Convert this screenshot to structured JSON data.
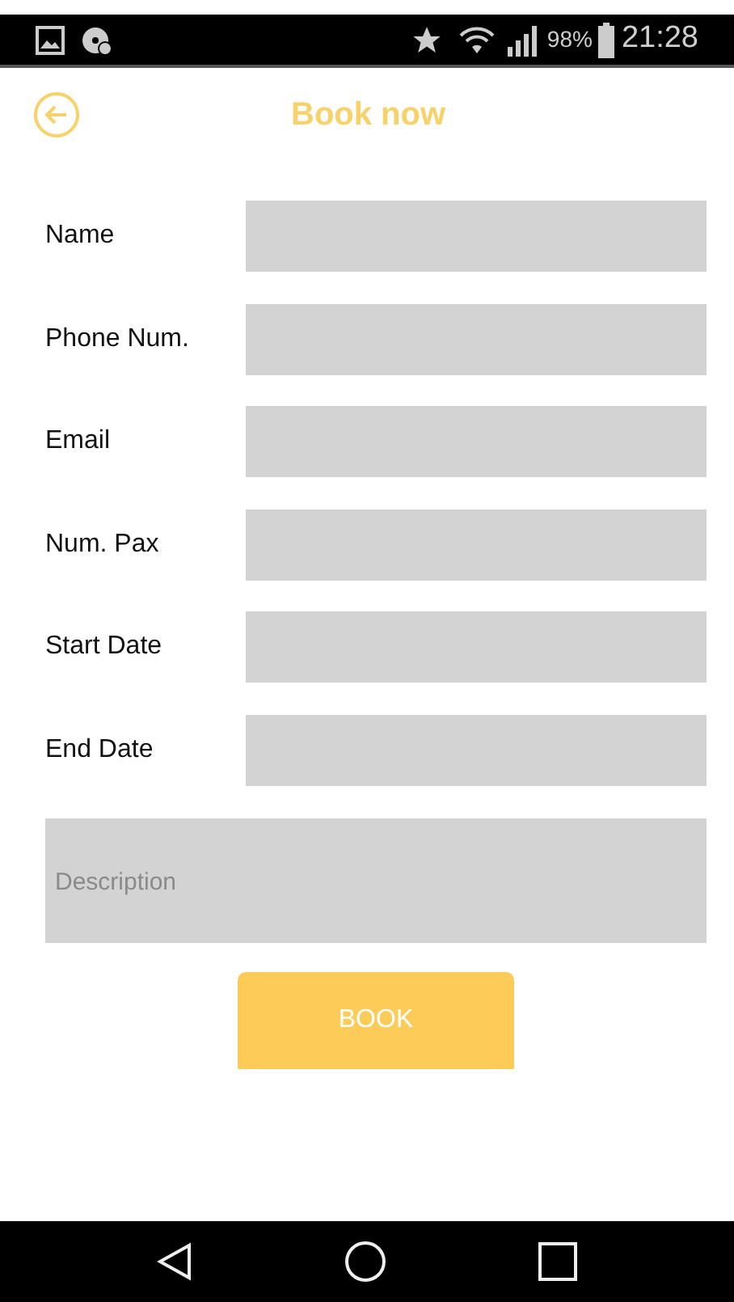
{
  "status_bar": {
    "battery": "98%",
    "time": "21:28"
  },
  "header": {
    "title": "Book now"
  },
  "fields": [
    {
      "label": "Name"
    },
    {
      "label": "Phone Num."
    },
    {
      "label": "Email"
    },
    {
      "label": "Num. Pax"
    },
    {
      "label": "Start Date"
    },
    {
      "label": "End Date"
    }
  ],
  "description": {
    "placeholder": "Description"
  },
  "book_button": "BOOK"
}
